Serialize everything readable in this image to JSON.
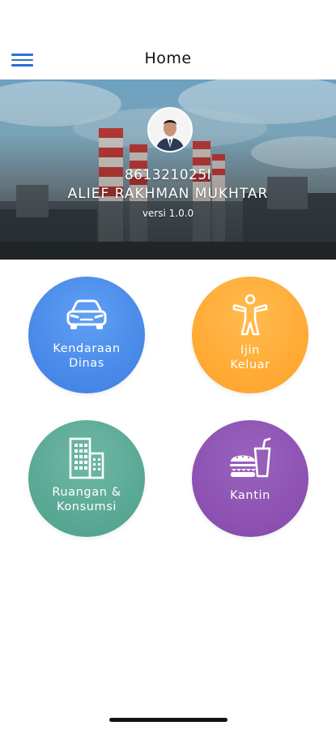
{
  "header": {
    "title": "Home",
    "menu_icon": "hamburger-menu-icon"
  },
  "profile": {
    "user_id": "861321025I",
    "name": "ALIEF RAKHMAN MUKHTAR",
    "version": "versi 1.0.0"
  },
  "menu": {
    "items": [
      {
        "label": "Kendaraan\nDinas",
        "icon": "car-icon",
        "color": "#4a8ae9"
      },
      {
        "label": "Ijin\nKeluar",
        "icon": "person-icon",
        "color": "#ffab36"
      },
      {
        "label": "Ruangan &\nKonsumsi",
        "icon": "building-icon",
        "color": "#5aa995"
      },
      {
        "label": "Kantin",
        "icon": "food-icon",
        "color": "#8e53b3"
      }
    ]
  },
  "colors": {
    "accent": "#2f6fd6",
    "text": "#111111",
    "white": "#ffffff"
  }
}
